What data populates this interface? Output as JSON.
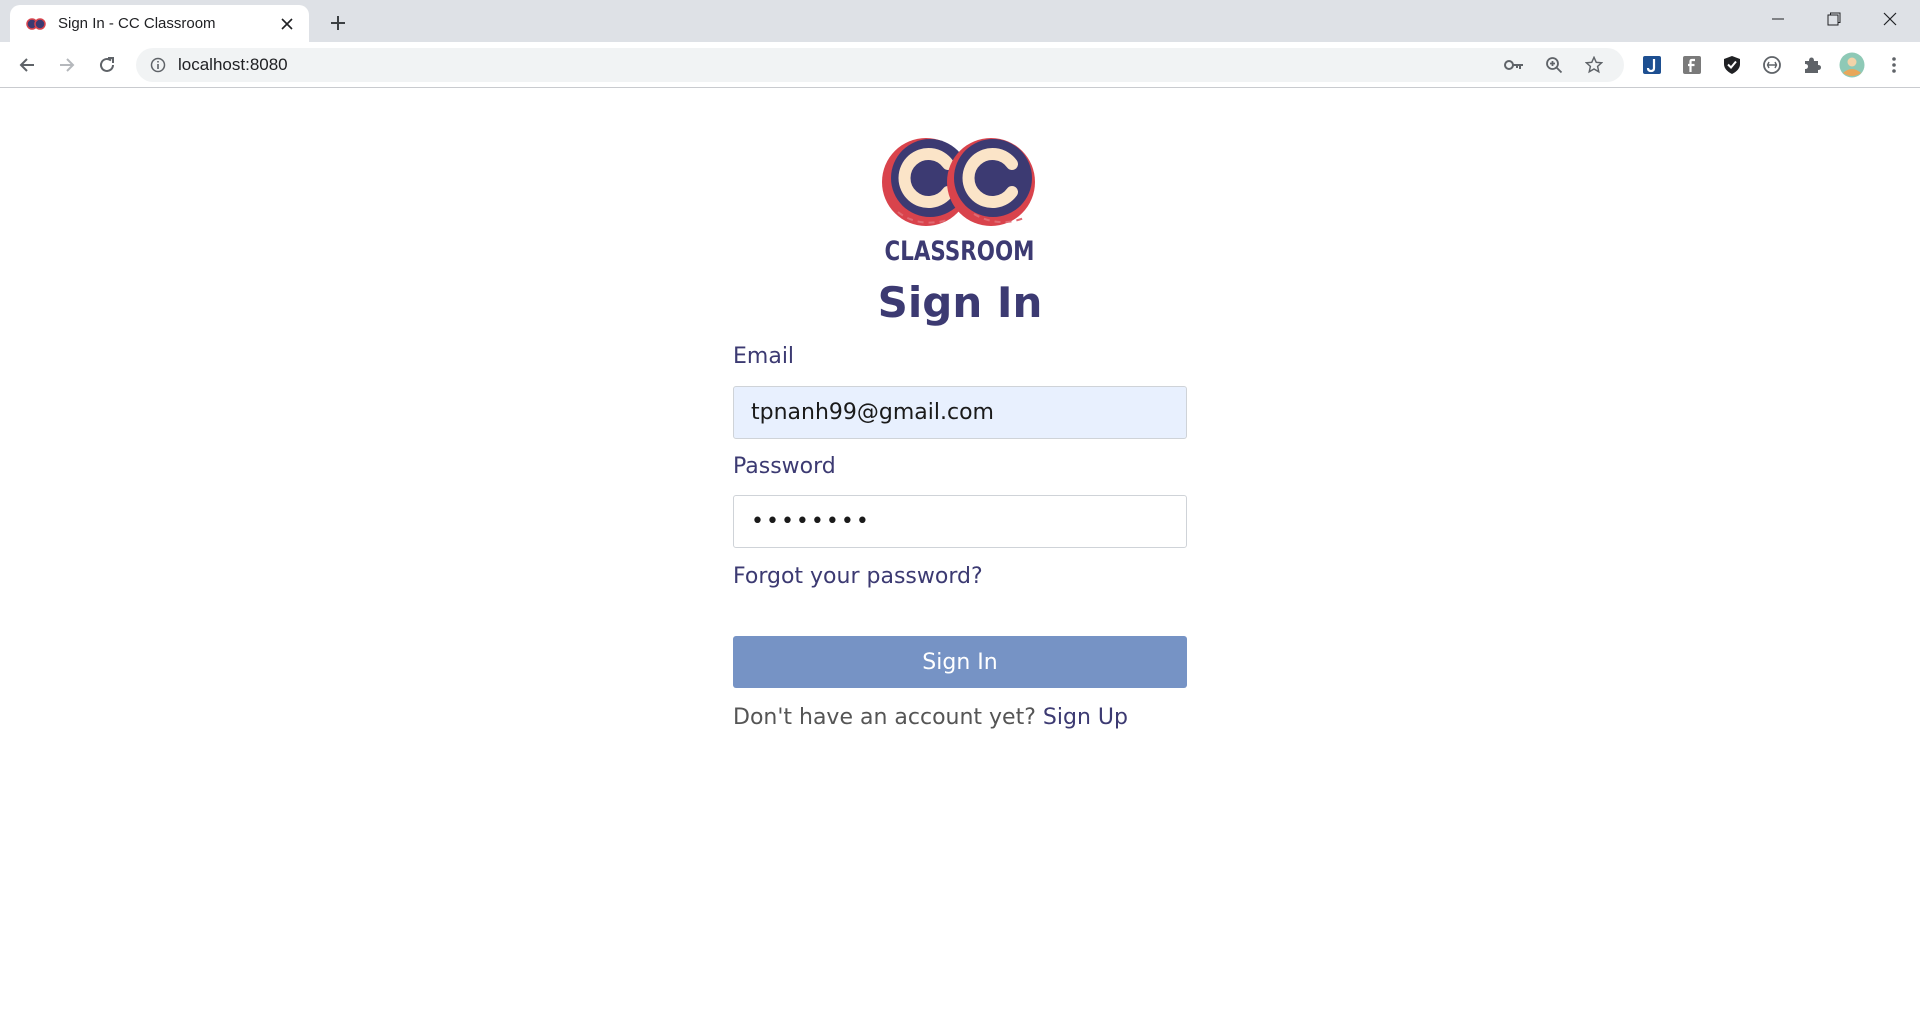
{
  "browser": {
    "tab_title": "Sign In - CC Classroom",
    "url": "localhost:8080"
  },
  "logo": {
    "letters": "CC",
    "wordmark": "CLASSROOM",
    "colors": {
      "navy": "#3c3a72",
      "red": "#d9434c",
      "cream": "#fbe4c8"
    }
  },
  "form": {
    "heading": "Sign In",
    "email_label": "Email",
    "email_value": "tpnanh99@gmail.com",
    "password_label": "Password",
    "password_value": "••••••••",
    "forgot_link": "Forgot your password?",
    "submit_label": "Sign In",
    "signup_prompt": "Don't have an account yet?",
    "signup_link": "Sign Up"
  },
  "colors": {
    "primary": "#3c3a72",
    "button": "#7693c5",
    "autofill_bg": "#e8f0fe"
  }
}
